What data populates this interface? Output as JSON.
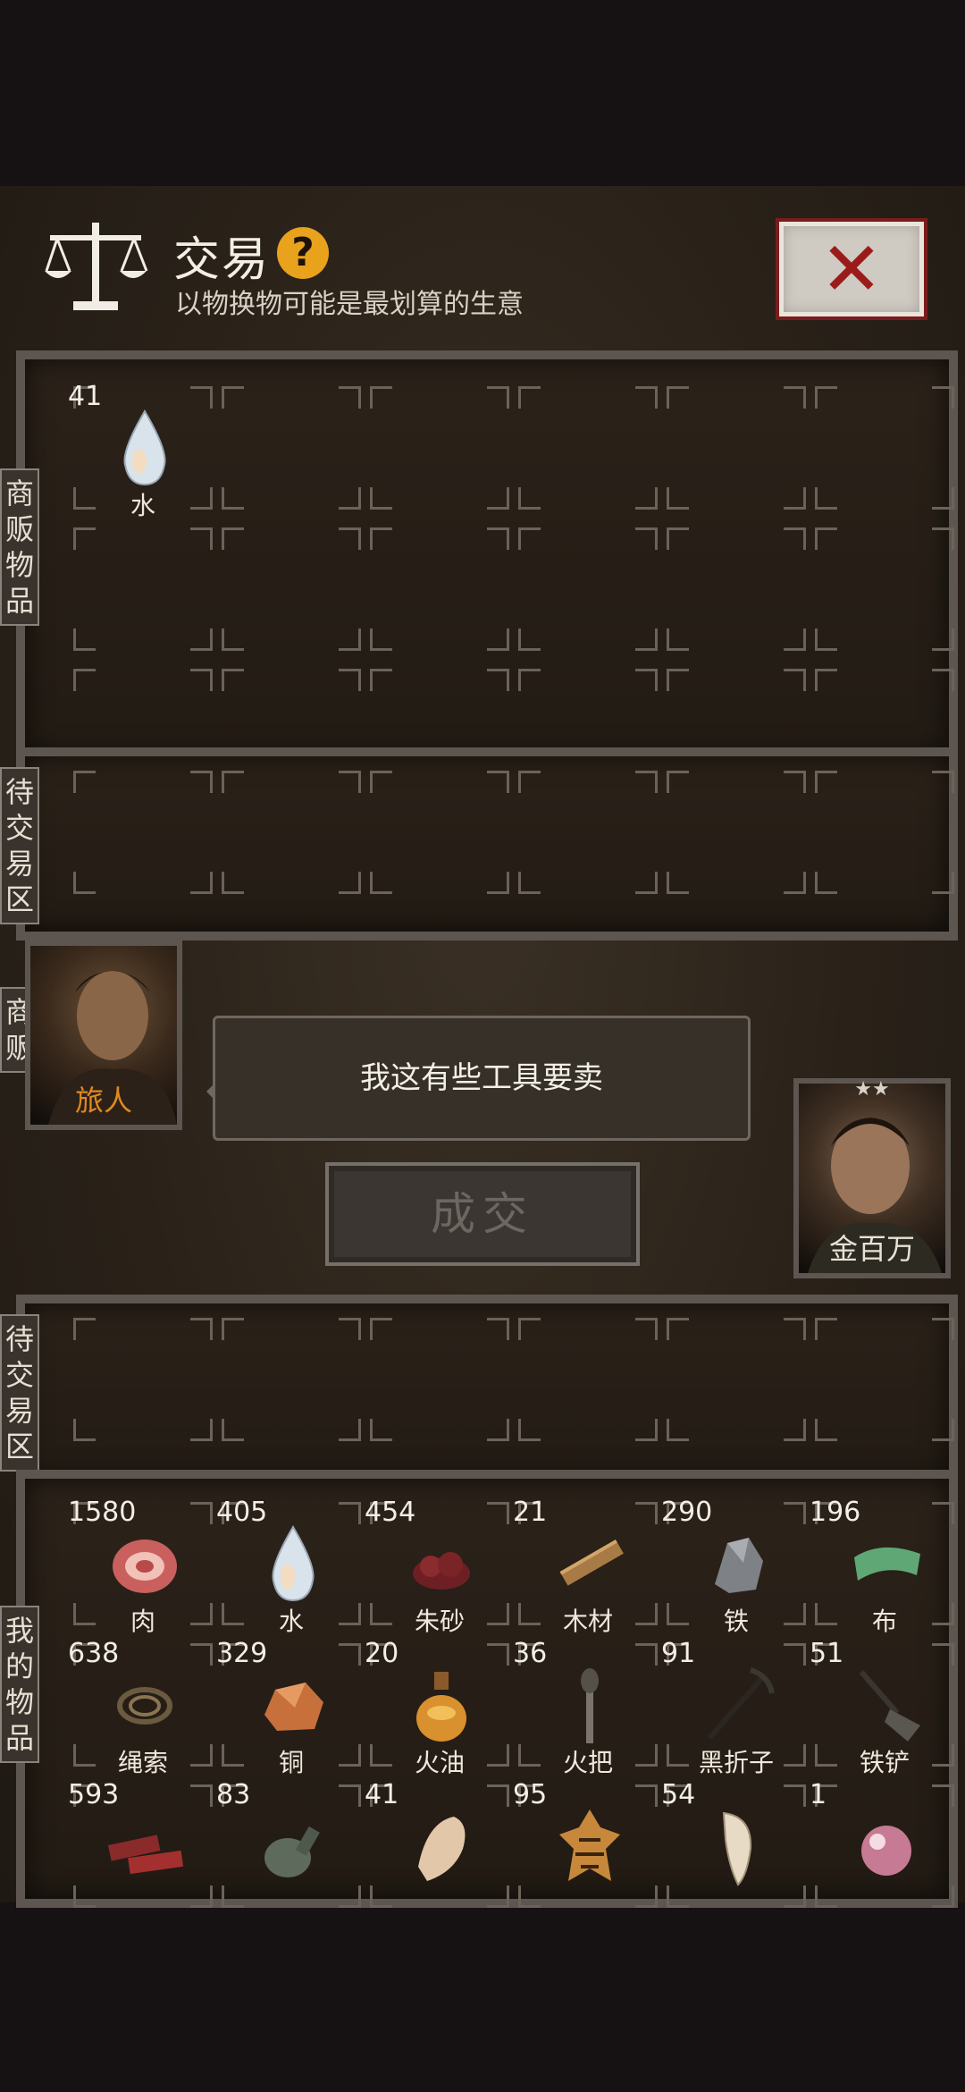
{
  "header": {
    "title": "交易",
    "help_label": "?",
    "subtitle": "以物换物可能是最划算的生意",
    "close_label": "✕"
  },
  "tabs": {
    "merchant_items": "商贩物品",
    "trade_zone_top": "待交易区",
    "merchant": "商贩",
    "trade_zone_bottom": "待交易区",
    "my_items": "我的物品"
  },
  "merchant_items": [
    {
      "count": "41",
      "name": "水",
      "icon": "water-drop-icon"
    }
  ],
  "merchant": {
    "name": "旅人",
    "name_color": "#e0891f",
    "dialogue": "我这有些工具要卖"
  },
  "player": {
    "name": "金百万",
    "stars": "★★"
  },
  "deal_button": "成交",
  "my_items": [
    {
      "count": "1580",
      "name": "肉",
      "icon": "meat-icon"
    },
    {
      "count": "405",
      "name": "水",
      "icon": "water-drop-icon"
    },
    {
      "count": "454",
      "name": "朱砂",
      "icon": "cinnabar-icon"
    },
    {
      "count": "21",
      "name": "木材",
      "icon": "wood-icon"
    },
    {
      "count": "290",
      "name": "铁",
      "icon": "iron-icon"
    },
    {
      "count": "196",
      "name": "布",
      "icon": "cloth-icon"
    },
    {
      "count": "638",
      "name": "绳索",
      "icon": "rope-icon"
    },
    {
      "count": "329",
      "name": "铜",
      "icon": "copper-icon"
    },
    {
      "count": "20",
      "name": "火油",
      "icon": "oil-flask-icon"
    },
    {
      "count": "36",
      "name": "火把",
      "icon": "torch-icon"
    },
    {
      "count": "91",
      "name": "黑折子",
      "icon": "pickaxe-icon"
    },
    {
      "count": "51",
      "name": "铁铲",
      "icon": "shovel-icon"
    },
    {
      "count": "593",
      "name": "",
      "icon": "jerky-icon"
    },
    {
      "count": "83",
      "name": "",
      "icon": "gourd-bottle-icon"
    },
    {
      "count": "41",
      "name": "",
      "icon": "bone-icon"
    },
    {
      "count": "95",
      "name": "",
      "icon": "tiger-pelt-icon"
    },
    {
      "count": "54",
      "name": "",
      "icon": "fang-icon"
    },
    {
      "count": "1",
      "name": "",
      "icon": "pearl-icon"
    }
  ],
  "colors": {
    "accent_help": "#e8a21c",
    "close_red": "#9b1b1b"
  }
}
